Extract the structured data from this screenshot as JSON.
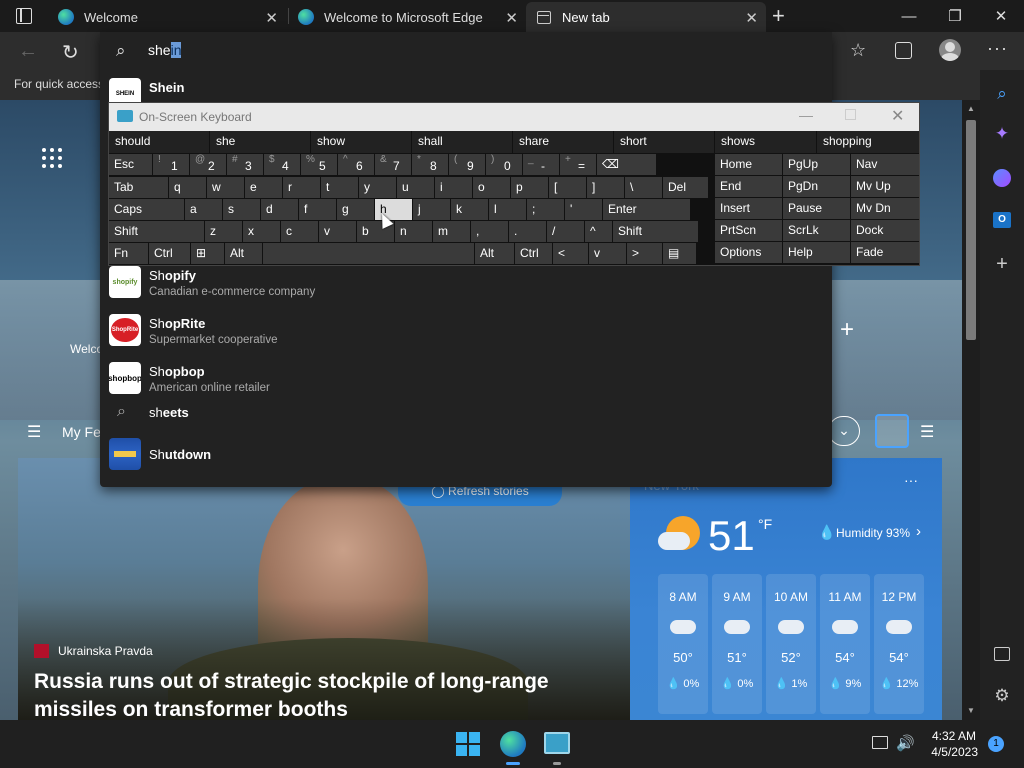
{
  "tabs": [
    {
      "label": "Welcome"
    },
    {
      "label": "Welcome to Microsoft Edge"
    },
    {
      "label": "New tab"
    }
  ],
  "window_controls": {
    "minimize": "—",
    "restore": "❐",
    "close": "✕",
    "new_tab": "+"
  },
  "address": {
    "typed_prefix": "she",
    "selected": "in"
  },
  "favbar_text": "For quick access",
  "suggestions": [
    {
      "bold_prefix": "Sh",
      "rest": "ein",
      "desc": "",
      "logo": "SHEIN"
    },
    {
      "bold_prefix": "Sh",
      "rest": "opify",
      "desc": "Canadian e-commerce company",
      "logo": "shopify"
    },
    {
      "bold_prefix": "Sh",
      "rest": "opRite",
      "desc": "Supermarket cooperative",
      "logo": "ShopRite"
    },
    {
      "bold_prefix": "Sh",
      "rest": "opbop",
      "desc": "American online retailer",
      "logo": "shopbop"
    },
    {
      "bold_prefix": "sh",
      "rest": "eets",
      "desc": "",
      "logo": ""
    },
    {
      "bold_prefix": "Sh",
      "rest": "utdown",
      "desc": "",
      "logo": ""
    }
  ],
  "osk": {
    "title": "On-Screen Keyboard",
    "predictions": [
      "should",
      "she",
      "show",
      "shall",
      "share",
      "short",
      "shows",
      "shopping"
    ],
    "row1": [
      [
        "Esc",
        ""
      ],
      [
        "1",
        "!"
      ],
      [
        "2",
        "@"
      ],
      [
        "3",
        "#"
      ],
      [
        "4",
        "$"
      ],
      [
        "5",
        "%"
      ],
      [
        "6",
        "^"
      ],
      [
        "7",
        "&"
      ],
      [
        "8",
        "*"
      ],
      [
        "9",
        "("
      ],
      [
        "0",
        ")"
      ],
      [
        "-",
        "_"
      ],
      [
        "=",
        "+"
      ],
      [
        "⌫",
        ""
      ]
    ],
    "row2": [
      "Tab",
      "q",
      "w",
      "e",
      "r",
      "t",
      "y",
      "u",
      "i",
      "o",
      "p",
      "[",
      "]",
      "\\",
      "Del"
    ],
    "row3": [
      "Caps",
      "a",
      "s",
      "d",
      "f",
      "g",
      "h",
      "j",
      "k",
      "l",
      ";",
      "'",
      "Enter"
    ],
    "row4": [
      "Shift",
      "z",
      "x",
      "c",
      "v",
      "b",
      "n",
      "m",
      ",",
      ".",
      "/",
      "^",
      "Shift"
    ],
    "row5": [
      "Fn",
      "Ctrl",
      "⊞",
      "Alt",
      "",
      "Alt",
      "Ctrl",
      "<",
      "v",
      ">",
      "▤"
    ],
    "nav": [
      [
        "Home",
        "PgUp",
        "Nav"
      ],
      [
        "End",
        "PgDn",
        "Mv Up"
      ],
      [
        "Insert",
        "Pause",
        "Mv Dn"
      ],
      [
        "PrtScn",
        "ScrLk",
        "Dock"
      ],
      [
        "Options",
        "Help",
        "Fade"
      ]
    ]
  },
  "page": {
    "welcome_partial": "Welco",
    "feed_label": "My Fe",
    "refresh_stories": "Refresh stories",
    "news_source": "Ukrainska Pravda",
    "headline": "Russia runs out of strategic stockpile of long-range missiles on transformer booths"
  },
  "weather": {
    "location_partial": "New York",
    "temp": "51",
    "unit": "°F",
    "humidity": "Humidity 93%",
    "hours": [
      {
        "time": "8 AM",
        "temp": "50°",
        "precip": "0%"
      },
      {
        "time": "9 AM",
        "temp": "51°",
        "precip": "0%"
      },
      {
        "time": "10 AM",
        "temp": "52°",
        "precip": "1%"
      },
      {
        "time": "11 AM",
        "temp": "54°",
        "precip": "9%"
      },
      {
        "time": "12 PM",
        "temp": "54°",
        "precip": "12%"
      }
    ]
  },
  "taskbar": {
    "time": "4:32 AM",
    "date": "4/5/2023",
    "notifications": "1"
  },
  "colors": {
    "accent": "#3b86d3",
    "edge_blue": "#1f7ac2"
  }
}
